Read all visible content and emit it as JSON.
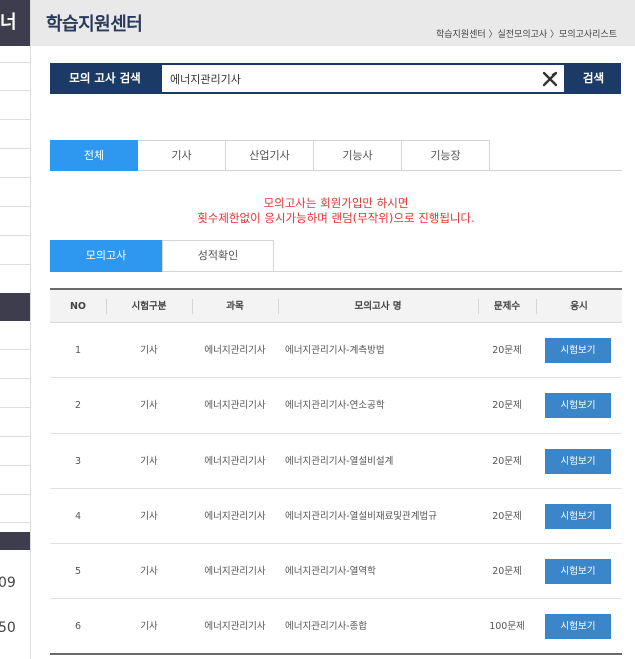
{
  "sidebar": {
    "top_char": "너",
    "numbers": [
      "09",
      "50"
    ]
  },
  "header": {
    "title": "학습지원센터",
    "breadcrumb": "학습지원센터 〉실전모의고사 〉모의고사리스트"
  },
  "search": {
    "label": "모의 고사 검색",
    "value": "에너지관리기사",
    "button": "검색"
  },
  "category_tabs": [
    {
      "label": "전체",
      "active": true
    },
    {
      "label": "기사",
      "active": false
    },
    {
      "label": "산업기사",
      "active": false
    },
    {
      "label": "기능사",
      "active": false
    },
    {
      "label": "기능장",
      "active": false
    }
  ],
  "notice": {
    "line1": "모의고사는 회원가입만 하시면",
    "line2": "횟수제한없이 응시가능하며 랜덤(무작위)으로 진행됩니다."
  },
  "sub_tabs": [
    {
      "label": "모의고사",
      "active": true
    },
    {
      "label": "성적확인",
      "active": false
    }
  ],
  "table": {
    "headers": [
      "NO",
      "시험구분",
      "과목",
      "모의고사 명",
      "문제수",
      "응시"
    ],
    "rows": [
      {
        "no": "1",
        "type": "기사",
        "subject": "에너지관리기사",
        "name": "에너지관리기사-계측방법",
        "count": "20문제",
        "action": "시험보기"
      },
      {
        "no": "2",
        "type": "기사",
        "subject": "에너지관리기사",
        "name": "에너지관리기사-연소공학",
        "count": "20문제",
        "action": "시험보기"
      },
      {
        "no": "3",
        "type": "기사",
        "subject": "에너지관리기사",
        "name": "에너지관리기사-열설비설계",
        "count": "20문제",
        "action": "시험보기"
      },
      {
        "no": "4",
        "type": "기사",
        "subject": "에너지관리기사",
        "name": "에너지관리기사-열설비재료및관계법규",
        "count": "20문제",
        "action": "시험보기"
      },
      {
        "no": "5",
        "type": "기사",
        "subject": "에너지관리기사",
        "name": "에너지관리기사-열역학",
        "count": "20문제",
        "action": "시험보기"
      },
      {
        "no": "6",
        "type": "기사",
        "subject": "에너지관리기사",
        "name": "에너지관리기사-종합",
        "count": "100문제",
        "action": "시험보기"
      }
    ]
  }
}
